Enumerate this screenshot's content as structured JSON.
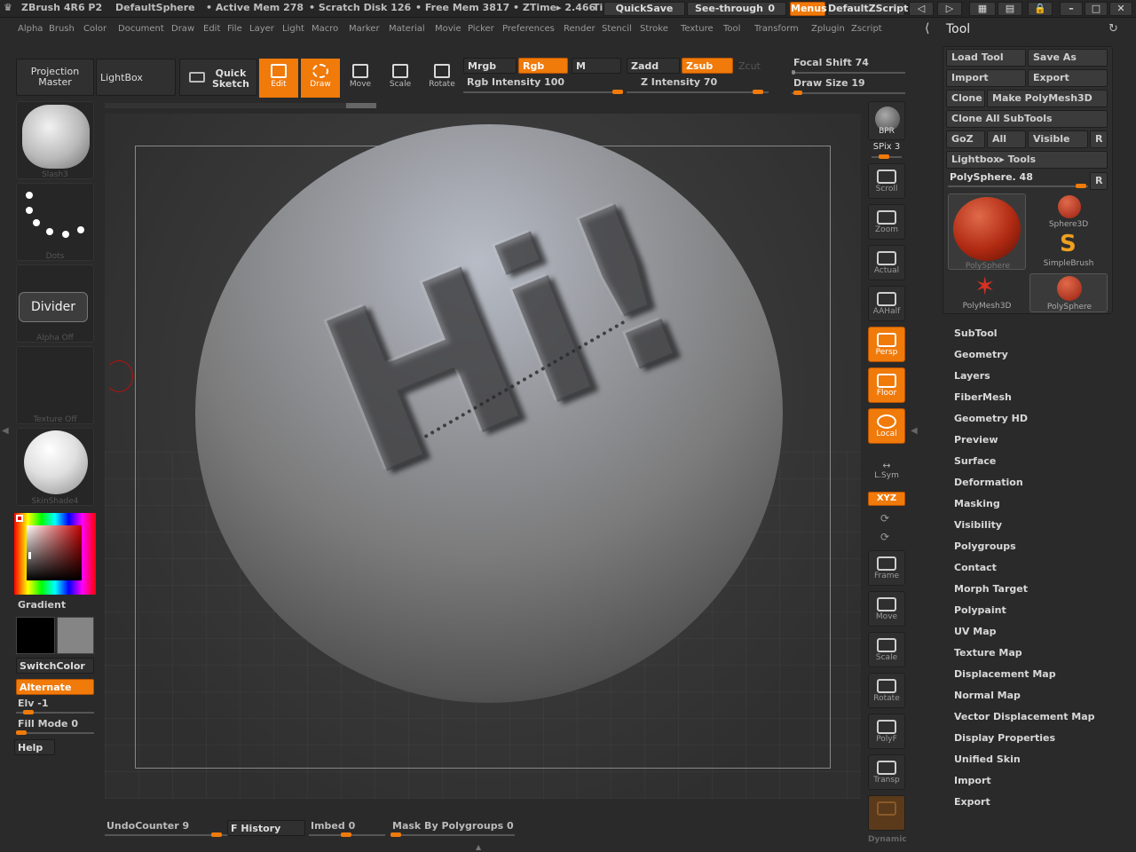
{
  "title_bar": {
    "app": "ZBrush 4R6 P2",
    "document": "DefaultSphere",
    "active_mem": "• Active Mem 278",
    "scratch_disk": "• Scratch Disk 126",
    "free_mem": "• Free Mem 3817",
    "ztime": "• ZTime▸ 2.466",
    "ztime_tail": "Ti",
    "quicksave": "QuickSave",
    "see_through": "See-through",
    "see_through_value": "0",
    "menus": "Menus",
    "default_zscript": "DefaultZScript"
  },
  "menu": [
    "Alpha",
    "Brush",
    "Color",
    "Document",
    "Draw",
    "Edit",
    "File",
    "Layer",
    "Light",
    "Macro",
    "Marker",
    "Material",
    "Movie",
    "Picker",
    "Preferences",
    "Render",
    "Stencil",
    "Stroke",
    "Texture",
    "Tool",
    "Transform",
    "Zplugin",
    "Zscript"
  ],
  "toolbar": {
    "projection_master": "Projection Master",
    "lightbox": "LightBox",
    "quick_sketch": "Quick Sketch",
    "edit": "Edit",
    "draw": "Draw",
    "move": "Move",
    "scale": "Scale",
    "rotate": "Rotate",
    "mrgb": "Mrgb",
    "rgb": "Rgb",
    "m": "M",
    "rgb_intensity": "Rgb Intensity 100",
    "zadd": "Zadd",
    "zsub": "Zsub",
    "zcut": "Zcut",
    "z_intensity": "Z Intensity 70",
    "focal_shift": "Focal Shift 74",
    "draw_size": "Draw Size 19"
  },
  "left_panel": {
    "brush": "Slash3",
    "stroke": "Dots",
    "alpha": "Alpha Off",
    "alpha_tooltip": "Divider",
    "texture": "Texture Off",
    "material": "SkinShade4",
    "gradient": "Gradient",
    "switch_color": "SwitchColor",
    "alternate": "Alternate",
    "elv": "Elv -1",
    "fill_mode": "Fill Mode 0",
    "help": "Help"
  },
  "canvas_text": "Hi!",
  "right_shelf": {
    "bpr": "BPR",
    "spix": "SPix 3",
    "scroll": "Scroll",
    "zoom": "Zoom",
    "actual": "Actual",
    "aahalf": "AAHalf",
    "persp": "Persp",
    "floor": "Floor",
    "local": "Local",
    "lsym": "L.Sym",
    "xyz": "XYZ",
    "frame": "Frame",
    "move": "Move",
    "scale": "Scale",
    "rotate": "Rotate",
    "polyf": "PolyF",
    "transp": "Transp",
    "dynamic": "Dynamic"
  },
  "tool_panel": {
    "title": "Tool",
    "load_tool": "Load Tool",
    "save_as": "Save As",
    "import": "Import",
    "export": "Export",
    "clone": "Clone",
    "make_polymesh": "Make PolyMesh3D",
    "clone_all": "Clone All SubTools",
    "goz": "GoZ",
    "all": "All",
    "visible": "Visible",
    "r": "R",
    "lightbox_tools": "Lightbox▸ Tools",
    "current_tool": "PolySphere. 48",
    "thumbs": [
      "PolySphere",
      "Sphere3D",
      "SimpleBrush",
      "PolyMesh3D",
      "PolySphere"
    ],
    "sections": [
      "SubTool",
      "Geometry",
      "Layers",
      "FiberMesh",
      "Geometry HD",
      "Preview",
      "Surface",
      "Deformation",
      "Masking",
      "Visibility",
      "Polygroups",
      "Contact",
      "Morph Target",
      "Polypaint",
      "UV Map",
      "Texture Map",
      "Displacement Map",
      "Normal Map",
      "Vector Displacement Map",
      "Display Properties",
      "Unified Skin",
      "Import",
      "Export"
    ]
  },
  "bottom": {
    "undo_counter": "UndoCounter 9",
    "history": "F History",
    "imbed": "Imbed 0",
    "mask_by_polygroups": "Mask By Polygroups 0"
  }
}
